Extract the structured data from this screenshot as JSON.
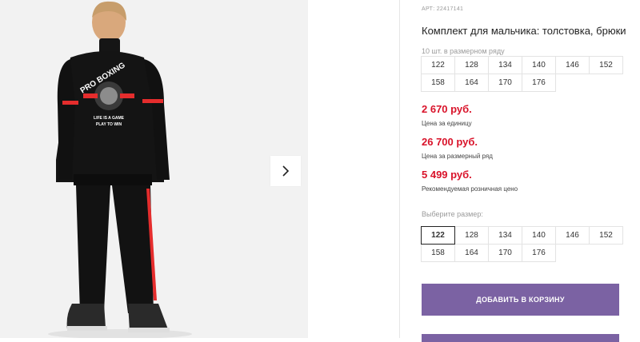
{
  "product": {
    "sku": "АРТ: 22417141",
    "title": "Комплект для мальчика: толстовка, брюки",
    "print_text": [
      "PRO BOXING",
      "LIFE IS A GAME",
      "PLAY TO WIN"
    ]
  },
  "pack": {
    "hint": "10 шт. в размерном ряду",
    "sizes": [
      "122",
      "128",
      "134",
      "140",
      "146",
      "152",
      "158",
      "164",
      "170",
      "176"
    ]
  },
  "prices": [
    {
      "value": "2 670 руб.",
      "label": "Цена за единицу"
    },
    {
      "value": "26 700 руб.",
      "label": "Цена за размерный ряд"
    },
    {
      "value": "5 499 руб.",
      "label": "Рекомендуемая розничная цено"
    }
  ],
  "selector": {
    "hint": "Выберите размер:",
    "sizes": [
      "122",
      "128",
      "134",
      "140",
      "146",
      "152",
      "158",
      "164",
      "170",
      "176"
    ],
    "selected": "122"
  },
  "actions": {
    "add_to_cart": "ДОБАВИТЬ В КОРЗИНУ"
  },
  "colors": {
    "accent": "#7b62a3",
    "price": "#d9132a",
    "print_red": "#e52d2d"
  },
  "icons": {
    "next": "chevron-right-icon"
  }
}
